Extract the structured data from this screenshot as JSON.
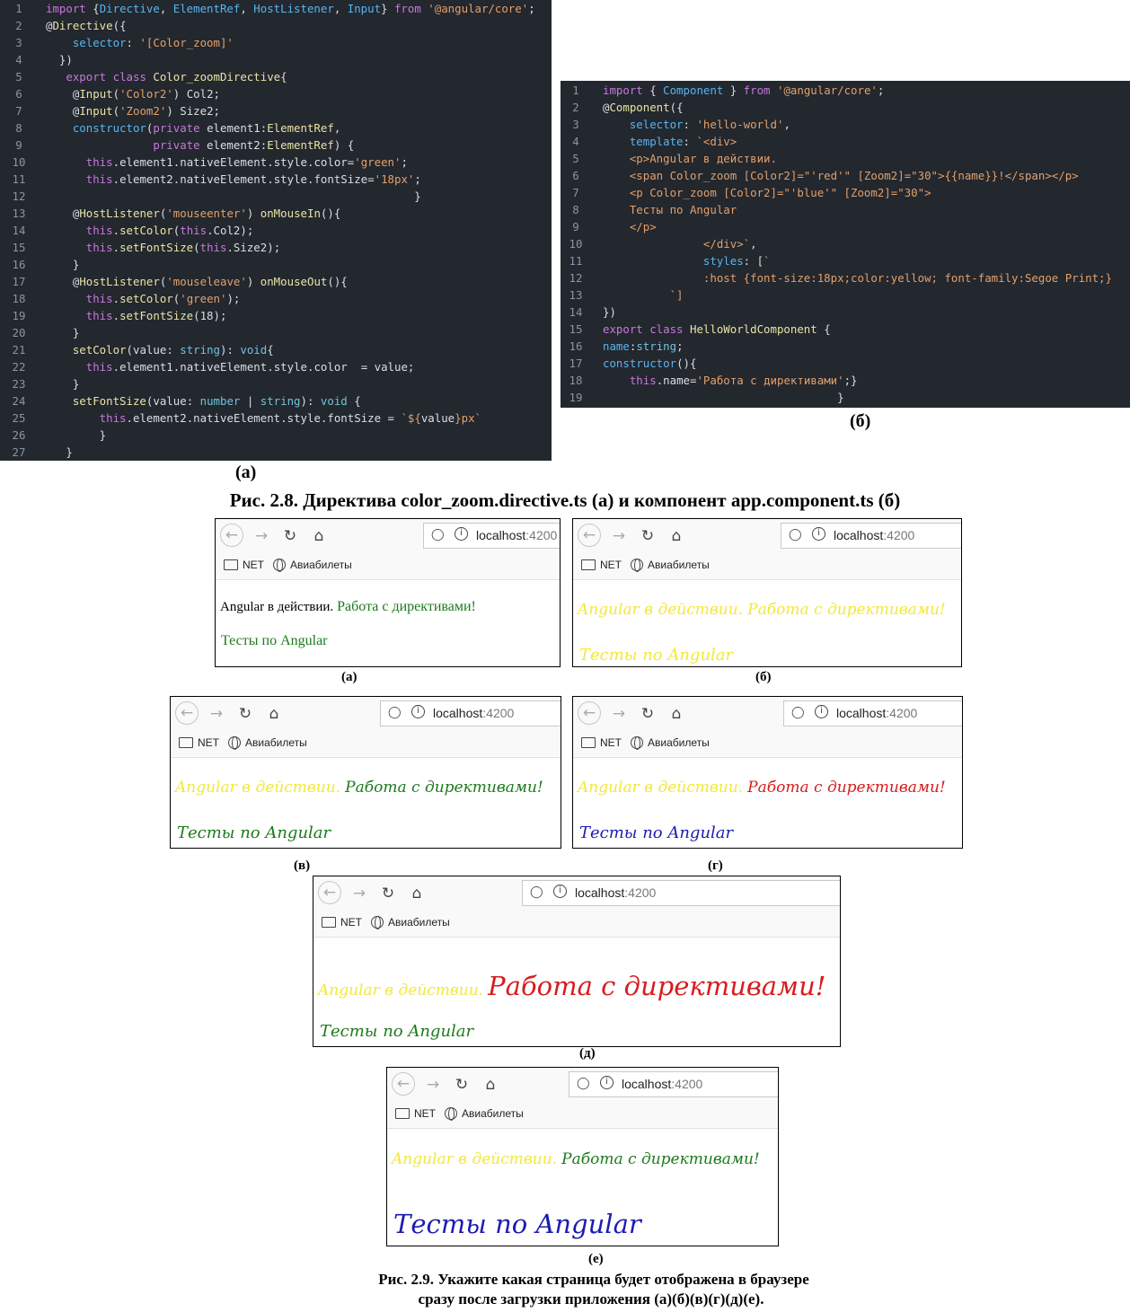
{
  "code_a": {
    "lines": [
      [
        [
          "import ",
          "k"
        ],
        [
          "{",
          "p"
        ],
        [
          "Directive",
          "kb"
        ],
        [
          ", ",
          "p"
        ],
        [
          "ElementRef",
          "kb"
        ],
        [
          ", ",
          "p"
        ],
        [
          "HostListener",
          "kb"
        ],
        [
          ", ",
          "p"
        ],
        [
          "Input",
          "kb"
        ],
        [
          "} ",
          "p"
        ],
        [
          "from ",
          "k"
        ],
        [
          "'@angular/core'",
          "s"
        ],
        [
          ";",
          "p"
        ]
      ],
      [
        [
          "@",
          "p"
        ],
        [
          "Directive",
          "f"
        ],
        [
          "({",
          "p"
        ]
      ],
      [
        [
          "    selector",
          "kb"
        ],
        [
          ": ",
          "p"
        ],
        [
          "'[Color_zoom]'",
          "s"
        ]
      ],
      [
        [
          "  })",
          "p"
        ]
      ],
      [
        [
          "   export ",
          "k"
        ],
        [
          "class ",
          "k"
        ],
        [
          "Color_zoomDirective",
          "f"
        ],
        [
          "{",
          "p"
        ]
      ],
      [
        [
          "    @",
          "p"
        ],
        [
          "Input",
          "f"
        ],
        [
          "(",
          "p"
        ],
        [
          "'Color2'",
          "s"
        ],
        [
          ") ",
          "p"
        ],
        [
          "Col2",
          "p"
        ],
        [
          ";",
          "p"
        ]
      ],
      [
        [
          "    @",
          "p"
        ],
        [
          "Input",
          "f"
        ],
        [
          "(",
          "p"
        ],
        [
          "'Zoom2'",
          "s"
        ],
        [
          ") ",
          "p"
        ],
        [
          "Size2",
          "p"
        ],
        [
          ";",
          "p"
        ]
      ],
      [
        [
          "    constructor",
          "kb"
        ],
        [
          "(",
          "p"
        ],
        [
          "private ",
          "k"
        ],
        [
          "element1",
          "p"
        ],
        [
          ":",
          "p"
        ],
        [
          "ElementRef",
          "f"
        ],
        [
          ",",
          "p"
        ]
      ],
      [
        [
          "                ",
          "p"
        ],
        [
          "private ",
          "k"
        ],
        [
          "element2",
          "p"
        ],
        [
          ":",
          "p"
        ],
        [
          "ElementRef",
          "f"
        ],
        [
          ") {",
          "p"
        ]
      ],
      [
        [
          "      this",
          "k"
        ],
        [
          ".",
          "p"
        ],
        [
          "element1",
          "p"
        ],
        [
          ".",
          "p"
        ],
        [
          "nativeElement",
          "p"
        ],
        [
          ".",
          "p"
        ],
        [
          "style",
          "p"
        ],
        [
          ".",
          "p"
        ],
        [
          "color",
          "p"
        ],
        [
          "=",
          "p"
        ],
        [
          "'green'",
          "s"
        ],
        [
          ";",
          "p"
        ]
      ],
      [
        [
          "      this",
          "k"
        ],
        [
          ".",
          "p"
        ],
        [
          "element2",
          "p"
        ],
        [
          ".",
          "p"
        ],
        [
          "nativeElement",
          "p"
        ],
        [
          ".",
          "p"
        ],
        [
          "style",
          "p"
        ],
        [
          ".",
          "p"
        ],
        [
          "fontSize",
          "p"
        ],
        [
          "=",
          "p"
        ],
        [
          "'18px'",
          "s"
        ],
        [
          ";",
          "p"
        ]
      ],
      [
        [
          "                                                       }",
          "p"
        ]
      ],
      [
        [
          "    @",
          "p"
        ],
        [
          "HostListener",
          "f"
        ],
        [
          "(",
          "p"
        ],
        [
          "'mouseenter'",
          "s"
        ],
        [
          ") ",
          "p"
        ],
        [
          "onMouseIn",
          "f"
        ],
        [
          "(){",
          "p"
        ]
      ],
      [
        [
          "      this",
          "k"
        ],
        [
          ".",
          "p"
        ],
        [
          "setColor",
          "f"
        ],
        [
          "(",
          "p"
        ],
        [
          "this",
          "k"
        ],
        [
          ".",
          "p"
        ],
        [
          "Col2",
          "p"
        ],
        [
          ");",
          "p"
        ]
      ],
      [
        [
          "      this",
          "k"
        ],
        [
          ".",
          "p"
        ],
        [
          "setFontSize",
          "f"
        ],
        [
          "(",
          "p"
        ],
        [
          "this",
          "k"
        ],
        [
          ".",
          "p"
        ],
        [
          "Size2",
          "p"
        ],
        [
          ");",
          "p"
        ]
      ],
      [
        [
          "    }",
          "p"
        ]
      ],
      [
        [
          "    @",
          "p"
        ],
        [
          "HostListener",
          "f"
        ],
        [
          "(",
          "p"
        ],
        [
          "'mouseleave'",
          "s"
        ],
        [
          ") ",
          "p"
        ],
        [
          "onMouseOut",
          "f"
        ],
        [
          "(){",
          "p"
        ]
      ],
      [
        [
          "      this",
          "k"
        ],
        [
          ".",
          "p"
        ],
        [
          "setColor",
          "f"
        ],
        [
          "(",
          "p"
        ],
        [
          "'green'",
          "s"
        ],
        [
          ");",
          "p"
        ]
      ],
      [
        [
          "      this",
          "k"
        ],
        [
          ".",
          "p"
        ],
        [
          "setFontSize",
          "f"
        ],
        [
          "(18);",
          "p"
        ]
      ],
      [
        [
          "    }",
          "p"
        ]
      ],
      [
        [
          "    setColor",
          "f"
        ],
        [
          "(",
          "p"
        ],
        [
          "value",
          "p"
        ],
        [
          ": ",
          "p"
        ],
        [
          "string",
          "ty"
        ],
        [
          "): ",
          "p"
        ],
        [
          "void",
          "ty"
        ],
        [
          "{",
          "p"
        ]
      ],
      [
        [
          "      this",
          "k"
        ],
        [
          ".",
          "p"
        ],
        [
          "element1",
          "p"
        ],
        [
          ".",
          "p"
        ],
        [
          "nativeElement",
          "p"
        ],
        [
          ".",
          "p"
        ],
        [
          "style",
          "p"
        ],
        [
          ".",
          "p"
        ],
        [
          "color  ",
          "p"
        ],
        [
          "= ",
          "p"
        ],
        [
          "value",
          "p"
        ],
        [
          ";",
          "p"
        ]
      ],
      [
        [
          "    }",
          "p"
        ]
      ],
      [
        [
          "    setFontSize",
          "f"
        ],
        [
          "(",
          "p"
        ],
        [
          "value",
          "p"
        ],
        [
          ": ",
          "p"
        ],
        [
          "number ",
          "ty"
        ],
        [
          "| ",
          "p"
        ],
        [
          "string",
          "ty"
        ],
        [
          "): ",
          "p"
        ],
        [
          "void ",
          "ty"
        ],
        [
          "{",
          "p"
        ]
      ],
      [
        [
          "        this",
          "k"
        ],
        [
          ".",
          "p"
        ],
        [
          "element2",
          "p"
        ],
        [
          ".",
          "p"
        ],
        [
          "nativeElement",
          "p"
        ],
        [
          ".",
          "p"
        ],
        [
          "style",
          "p"
        ],
        [
          ".",
          "p"
        ],
        [
          "fontSize ",
          "p"
        ],
        [
          "= ",
          "p"
        ],
        [
          "`${",
          "s"
        ],
        [
          "value",
          "p"
        ],
        [
          "}px`",
          "s"
        ]
      ],
      [
        [
          "        }",
          "p"
        ]
      ],
      [
        [
          "   }",
          "p"
        ]
      ]
    ]
  },
  "code_b": {
    "lines": [
      [
        [
          "import ",
          "k"
        ],
        [
          "{ ",
          "p"
        ],
        [
          "Component ",
          "kb"
        ],
        [
          "} ",
          "p"
        ],
        [
          "from ",
          "k"
        ],
        [
          "'@angular/core'",
          "s"
        ],
        [
          ";",
          "p"
        ]
      ],
      [
        [
          "@",
          "p"
        ],
        [
          "Component",
          "f"
        ],
        [
          "({",
          "p"
        ]
      ],
      [
        [
          "    selector",
          "kb"
        ],
        [
          ": ",
          "p"
        ],
        [
          "'hello-world'",
          "s"
        ],
        [
          ",",
          "p"
        ]
      ],
      [
        [
          "    template",
          "kb"
        ],
        [
          ": ",
          "p"
        ],
        [
          "`<div>",
          "s"
        ]
      ],
      [
        [
          "    <p>Angular в действии.",
          "s"
        ]
      ],
      [
        [
          "    <span Color_zoom [Color2]=\"'red'\" [Zoom2]=\"30\">{{name}}!</span></p>",
          "s"
        ]
      ],
      [
        [
          "    <p Color_zoom [Color2]=\"'blue'\" [Zoom2]=\"30\">",
          "s"
        ]
      ],
      [
        [
          "    Тесты по Angular",
          "s"
        ]
      ],
      [
        [
          "    </p>",
          "s"
        ]
      ],
      [
        [
          "               </div>`",
          "s"
        ],
        [
          ",",
          "p"
        ]
      ],
      [
        [
          "               styles",
          "kb"
        ],
        [
          ": [",
          "p"
        ],
        [
          "`",
          "s"
        ]
      ],
      [
        [
          "               :host {font-size:18px;color:yellow; font-family:Segoe Print;}",
          "s"
        ]
      ],
      [
        [
          "          `]",
          "s"
        ]
      ],
      [
        [
          "})",
          "p"
        ]
      ],
      [
        [
          "export ",
          "k"
        ],
        [
          "class ",
          "k"
        ],
        [
          "HelloWorldComponent ",
          "f"
        ],
        [
          "{",
          "p"
        ]
      ],
      [
        [
          "name",
          "kb"
        ],
        [
          ":",
          "p"
        ],
        [
          "string",
          "ty"
        ],
        [
          ";",
          "p"
        ]
      ],
      [
        [
          "constructor",
          "kb"
        ],
        [
          "(){",
          "p"
        ]
      ],
      [
        [
          "    this",
          "k"
        ],
        [
          ".",
          "p"
        ],
        [
          "name",
          "p"
        ],
        [
          "=",
          "p"
        ],
        [
          "'Работа с директивами'",
          "s"
        ],
        [
          ";}",
          "p"
        ]
      ],
      [
        [
          "                                   }",
          "p"
        ]
      ]
    ]
  },
  "captions": {
    "code_a_label": "(а)",
    "code_b_label": "(б)",
    "figure_28": "Рис. 2.8. Директива color_zoom.directive.ts (а) и компонент app.component.ts (б)",
    "figure_29_line1": "Рис. 2.9. Укажите какая страница будет отображена в браузере",
    "figure_29_line2": "сразу после загрузки приложения (а)(б)(в)(г)(д)(е)."
  },
  "browser_common": {
    "url_host": "localhost",
    "url_port": ":4200",
    "bookmark_1": "NET",
    "bookmark_2": "Авиабилеты",
    "icons": [
      "back-icon",
      "forward-icon",
      "reload-icon",
      "home-icon",
      "shield-icon",
      "info-icon",
      "folder-icon",
      "globe-icon"
    ]
  },
  "browsers": [
    {
      "label": "(а)",
      "line1_a": "Angular в действии.",
      "line1_b": "Работа с директивами!",
      "line2": "Тесты по Angular",
      "colors": {
        "line1_a": "#000000",
        "line1_b": "#1c7a1c",
        "line2": "#1c7a1c"
      }
    },
    {
      "label": "(б)",
      "line1_a": "Angular в действии.",
      "line1_b": "Работа с директивами!",
      "line2": "Тесты по Angular",
      "colors": {
        "line1_a": "#f2e83a",
        "line1_b": "#f2e83a",
        "line2": "#f2e83a"
      }
    },
    {
      "label": "(в)",
      "line1_a": "Angular в действии.",
      "line1_b": "Работа с директивами!",
      "line2": "Тесты по Angular",
      "colors": {
        "line1_a": "#f2e83a",
        "line1_b": "#1c7a1c",
        "line2": "#1c7a1c"
      }
    },
    {
      "label": "(г)",
      "line1_a": "Angular в действии.",
      "line1_b": "Работа с директивами!",
      "line2": "Тесты по Angular",
      "colors": {
        "line1_a": "#f2e83a",
        "line1_b": "#d71c1c",
        "line2": "#1c1cb0"
      }
    },
    {
      "label": "(д)",
      "line1_a": "Angular в действии.",
      "line1_b": "Работа с директивами!",
      "line2": "Тесты по Angular",
      "colors": {
        "line1_a": "#f2e83a",
        "line1_b": "#d71c1c",
        "line2": "#1c7a1c"
      }
    },
    {
      "label": "(е)",
      "line1_a": "Angular в действии.",
      "line1_b": "Работа с директивами!",
      "line2": "Тесты по Angular",
      "colors": {
        "line1_a": "#f2e83a",
        "line1_b": "#1c7a1c",
        "line2": "#1c1cb0"
      }
    }
  ]
}
